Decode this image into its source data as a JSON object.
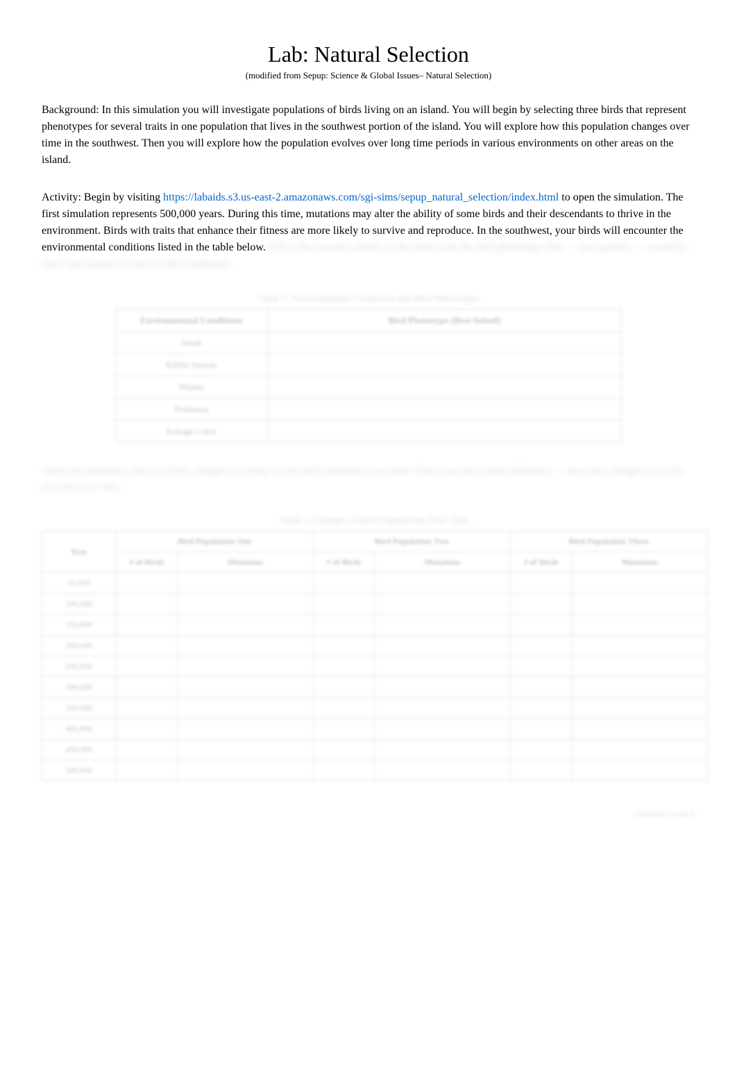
{
  "title": "Lab: Natural Selection",
  "subtitle": "(modified from Sepup: Science & Global Issues– Natural Selection)",
  "background_label": "Background:",
  "background_text": " In this simulation you will investigate populations of birds living on an island. You will begin by selecting three birds that represent phenotypes for several traits in one population that lives in the southwest portion of the island. You will explore how this population changes over time in the southwest. Then you will explore how the population evolves over long time periods in various environments on other areas on the island.",
  "activity_label": "Activity:",
  "activity_prefix": " Begin by visiting ",
  "activity_link": "https://labaids.s3.us-east-2.amazonaws.com/sgi-sims/sepup_natural_selection/index.html",
  "activity_suffix": " to open the simulation. The first simulation represents 500,000 years. During this time, mutations may alter the ability of some birds and their descendants to thrive in the environment. Birds with traits that enhance their fitness are more likely to survive and reproduce. In the southwest, your birds will encounter the environmental conditions listed in the table below. ",
  "activity_blurred": "Fill in the second column of the chart with the bird phenotype that — you predict — would be most best suited for each of the conditions.",
  "table1": {
    "caption": "Table 1: Environmental Conditions and Bird Phenotypes",
    "headers": [
      "Environmental Conditions",
      "Bird Phenotype (Best Suited)"
    ],
    "rows": [
      "Seeds",
      "Edible Insects",
      "Worms",
      "Predators",
      "Foliage Color"
    ]
  },
  "instruction2": "Watch the animation and record the changes occurring in each bird population over time. Then your best within difference — note what changes occur for you bird over time.",
  "table2": {
    "caption": "Table 2: Changes in Bird Populations Over Time",
    "pop_headers": [
      "Bird Population One",
      "Bird Population Two",
      "Bird Population Three"
    ],
    "sub_headers": [
      "Year",
      "# of Birds",
      "Mutations",
      "# of Birds",
      "Mutations",
      "# of Birds",
      "Mutations"
    ],
    "years": [
      "50,000",
      "100,000",
      "150,000",
      "200,000",
      "250,000",
      "300,000",
      "350,000",
      "400,000",
      "450,000",
      "500,000"
    ]
  },
  "footer": "continued on back"
}
